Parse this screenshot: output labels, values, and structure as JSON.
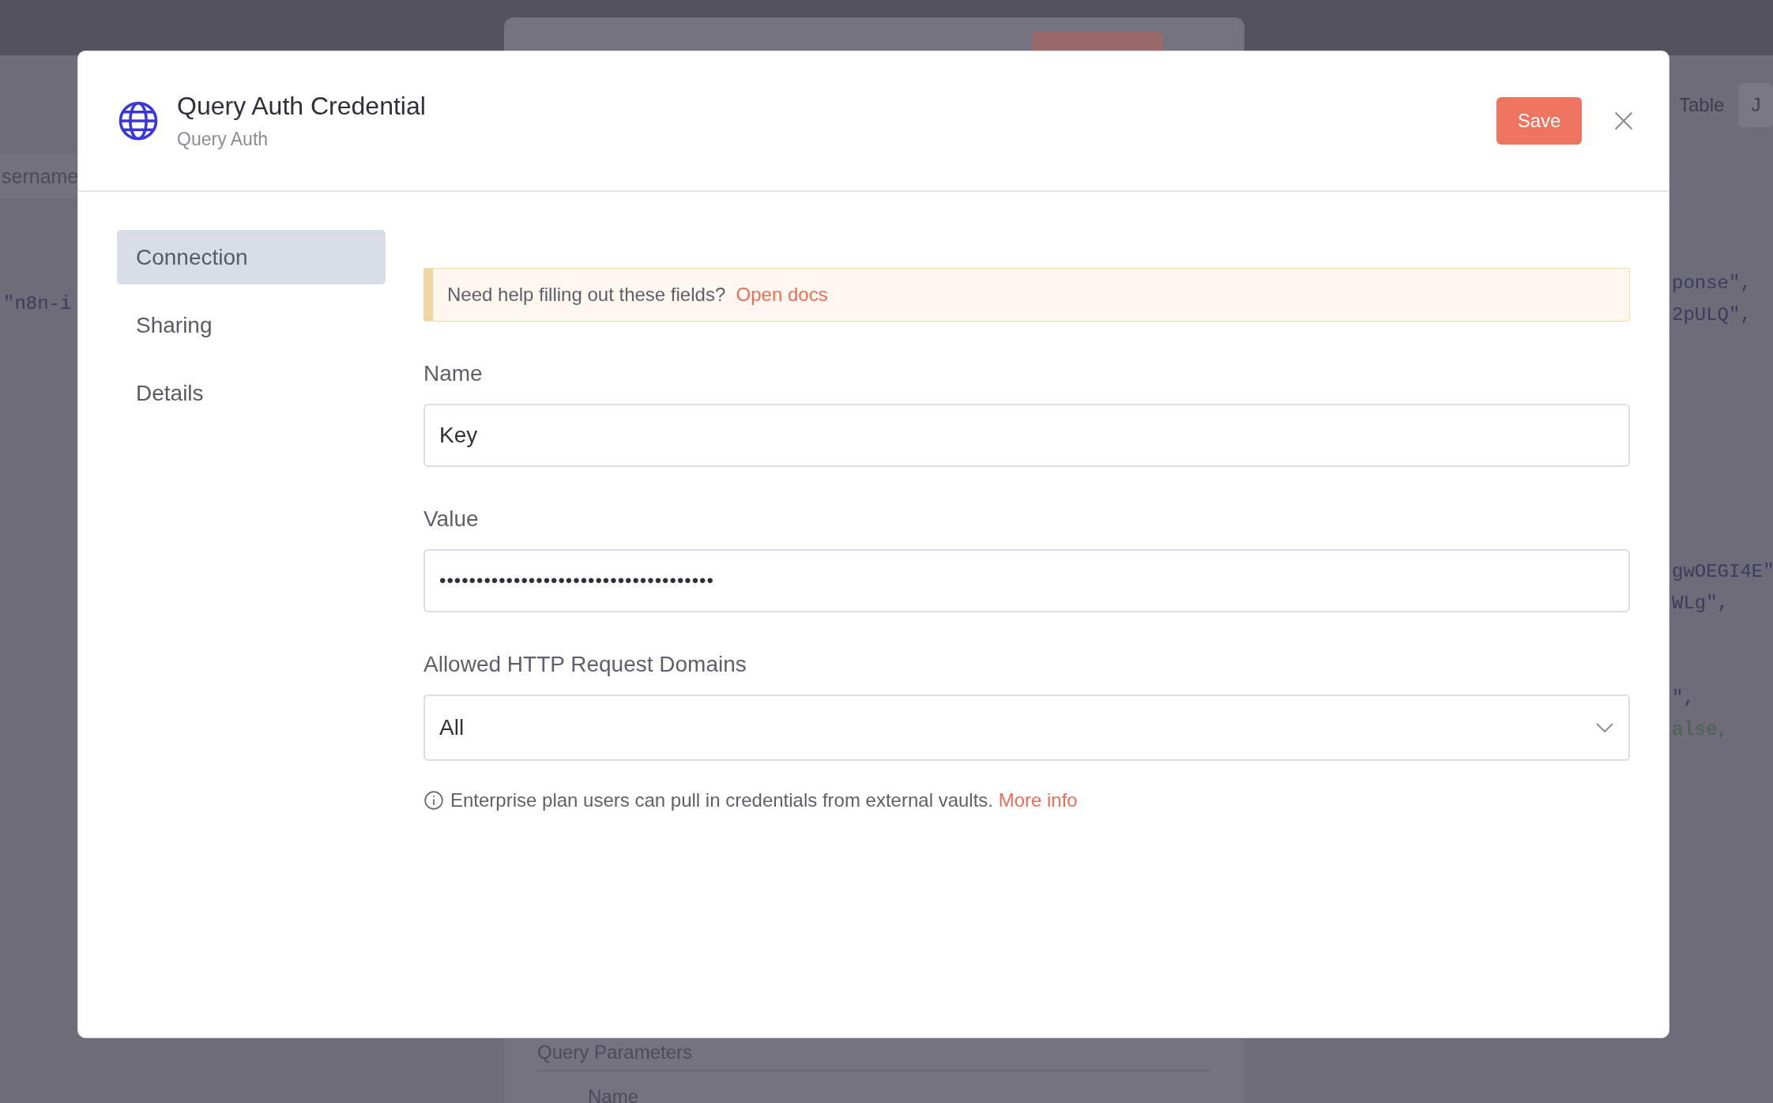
{
  "background": {
    "left_panel": {
      "column_header": "sername",
      "code_line": "\"n8n-i"
    },
    "center_panel": {
      "section_title": "Query Parameters",
      "field_label": "Name"
    },
    "right_panel": {
      "tabs": [
        {
          "label": "Table",
          "selected": false
        },
        {
          "label": "J",
          "selected": true
        }
      ],
      "code_groups": [
        {
          "lines": [
            {
              "text": "ponse\",",
              "kind": "string"
            },
            {
              "text": "2pULQ\",",
              "kind": "string"
            }
          ]
        },
        {
          "lines": [
            {
              "text": "gwOEGI4E\"",
              "kind": "string"
            },
            {
              "text": "WLg\",",
              "kind": "string"
            }
          ]
        },
        {
          "lines": [
            {
              "text": "\",",
              "kind": "string"
            },
            {
              "text": "alse,",
              "kind": "boolean"
            }
          ]
        }
      ]
    }
  },
  "modal": {
    "title": "Query Auth Credential",
    "subtitle": "Query Auth",
    "save_button": "Save",
    "sidebar": [
      {
        "label": "Connection",
        "selected": true
      },
      {
        "label": "Sharing",
        "selected": false
      },
      {
        "label": "Details",
        "selected": false
      }
    ],
    "notice": {
      "text": "Need help filling out these fields?",
      "link": "Open docs"
    },
    "fields": [
      {
        "kind": "text",
        "label": "Name",
        "value": "Key"
      },
      {
        "kind": "password",
        "label": "Value",
        "value": "•••••••••••••••••••••••••••••••••••••"
      },
      {
        "kind": "select",
        "label": "Allowed HTTP Request Domains",
        "value": "All"
      }
    ],
    "info": {
      "text": "Enterprise plan users can pull in credentials from external vaults.",
      "link": "More info"
    }
  }
}
